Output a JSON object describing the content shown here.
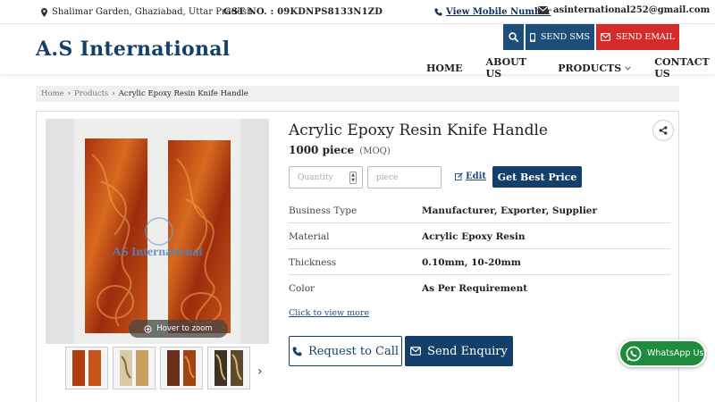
{
  "topbar": {
    "address": "Shalimar Garden, Ghaziabad, Uttar Pradesh",
    "gst": "GST NO. : 09KDNPS8133N1ZD",
    "mobile_link": "View Mobile Number",
    "email": "asinternational252@gmail.com"
  },
  "header": {
    "logo": "A.S International",
    "send_sms": "SEND SMS",
    "send_email": "SEND EMAIL",
    "nav": [
      "HOME",
      "ABOUT US",
      "PRODUCTS",
      "CONTACT US"
    ]
  },
  "breadcrumb": [
    "Home",
    "Products",
    "Acrylic Epoxy Resin Knife Handle"
  ],
  "product": {
    "title": "Acrylic Epoxy Resin Knife Handle",
    "moq_value": "1000 piece",
    "moq_label": "(MOQ)",
    "quantity_placeholder": "Quantity",
    "unit_placeholder": "piece",
    "edit_label": "Edit",
    "best_price_label": "Get Best Price",
    "hover_zoom": "Hover to zoom",
    "watermark": "AS International",
    "specs": [
      {
        "key": "Business Type",
        "value": "Manufacturer, Exporter, Supplier"
      },
      {
        "key": "Material",
        "value": "Acrylic Epoxy Resin"
      },
      {
        "key": "Thickness",
        "value": "0.10mm, 10-20mm"
      },
      {
        "key": "Color",
        "value": "As Per Requirement"
      }
    ],
    "view_more": "Click to view more",
    "request_call": "Request to Call",
    "send_enquiry": "Send Enquiry"
  },
  "whatsapp": "WhatsApp Us",
  "colors": {
    "brand_navy": "#143f6b",
    "button_blue": "#1d4e7a",
    "email_red": "#d52b2b",
    "whatsapp_green": "#1e8c3a",
    "resin_orange": "#c4501a"
  }
}
